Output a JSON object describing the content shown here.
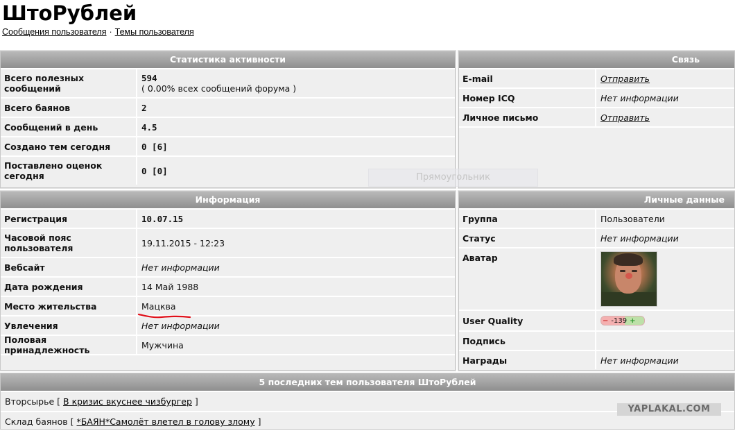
{
  "page": {
    "username_title": "ШтоРублей",
    "link_posts": "Сообщения пользователя",
    "link_sep": "·",
    "link_topics": "Темы пользователя"
  },
  "activity": {
    "header": "Статистика активности",
    "rows": [
      {
        "label": "Всего полезных сообщений",
        "value": "594",
        "sub": "( 0.00% всех сообщений форума )"
      },
      {
        "label": "Всего баянов",
        "value": "2"
      },
      {
        "label": "Сообщений в день",
        "value": "4.5"
      },
      {
        "label": "Создано тем сегодня",
        "value": "0 [6]"
      },
      {
        "label": "Поставлено оценок сегодня",
        "value": "0 [0]"
      }
    ]
  },
  "contact": {
    "header": "Связь",
    "rows": [
      {
        "label": "E-mail",
        "value": "Отправить"
      },
      {
        "label": "Номер ICQ",
        "value": "Нет информации"
      },
      {
        "label": "Личное письмо",
        "value": "Отправить"
      }
    ]
  },
  "info": {
    "header": "Информация",
    "rows": [
      {
        "label": "Регистрация",
        "value": "10.07.15"
      },
      {
        "label": "Часовой пояс пользователя",
        "value": "19.11.2015 - 12:23"
      },
      {
        "label": "Вебсайт",
        "value": "Нет информации"
      },
      {
        "label": "Дата рождения",
        "value": "14 Май 1988"
      },
      {
        "label": "Место жительства",
        "value": "Мацква"
      },
      {
        "label": "Увлечения",
        "value": "Нет информации"
      },
      {
        "label": "Половая принадлежность",
        "value": "Мужчина"
      }
    ]
  },
  "personal": {
    "header": "Личные данные",
    "rows": [
      {
        "label": "Группа",
        "value": "Пользователи"
      },
      {
        "label": "Статус",
        "value": "Нет информации"
      },
      {
        "label": "Аватар",
        "value": ""
      },
      {
        "label": "User Quality",
        "minus": "−",
        "score": "-139",
        "plus": "+"
      },
      {
        "label": "Подпись",
        "value": ""
      },
      {
        "label": "Награды",
        "value": "Нет информации"
      }
    ]
  },
  "recent": {
    "header": "5 последних тем пользователя ШтоРублей",
    "rows": [
      {
        "section": "Вторсырье",
        "open": "[",
        "topic": "В кризис вкуснее чизбургер",
        "close": "]"
      },
      {
        "section": "Склад баянов",
        "open": "[",
        "topic": "*БАЯН*Самолёт влетел в голову злому",
        "close": "]"
      }
    ]
  },
  "overlay": {
    "ghost_label": "Прямоугольник",
    "watermark": "YAPLAKAL.COM"
  },
  "colors": {
    "header_grad_top": "#b9b9b9",
    "header_grad_bottom": "#8f8f8f",
    "panel_bg": "#efefef",
    "underline_annotation": "#e0101a"
  }
}
